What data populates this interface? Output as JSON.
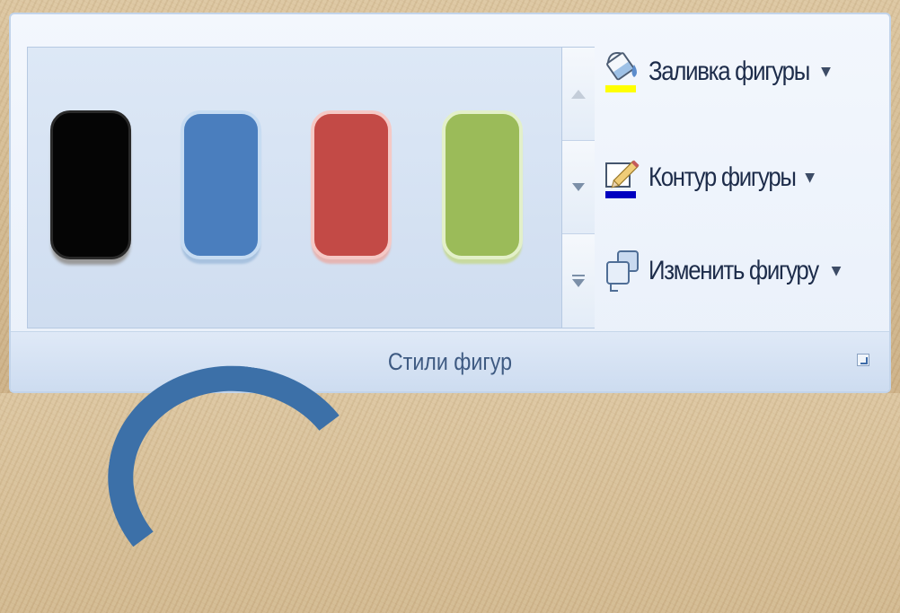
{
  "ribbon_group": {
    "title": "Стили фигур",
    "commands": {
      "fill": {
        "label": "Заливка фигуры",
        "icon": "paint-bucket-icon"
      },
      "outline": {
        "label": "Контур фигуры",
        "icon": "pencil-outline-icon"
      },
      "change": {
        "label": "Изменить фигуру",
        "icon": "change-shape-icon"
      }
    },
    "dropdown_arrow": "▼",
    "gallery": {
      "styles": [
        {
          "name": "black",
          "fill": "#050505",
          "edge": "#2a2a2a"
        },
        {
          "name": "blue",
          "fill": "#4a7ebe",
          "edge": "#c7dcf2"
        },
        {
          "name": "red",
          "fill": "#c34a46",
          "edge": "#f5c9c6"
        },
        {
          "name": "green",
          "fill": "#9bbb59",
          "edge": "#e3f0c9"
        }
      ]
    }
  },
  "colors": {
    "fill_underline": "#ffff00",
    "outline_underline": "#0000c0"
  }
}
